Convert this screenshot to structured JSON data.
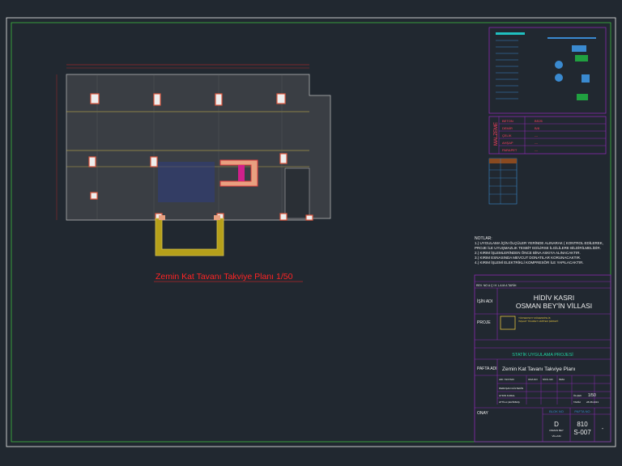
{
  "plan": {
    "title": "Zemin Kat Tavanı Takviye Planı  1/50"
  },
  "notes": {
    "heading": "NOTLAR:",
    "lines": [
      "1.) UYGULAMA İÇİN ÖLÇÜLER YERİNDE ALINARAK ( KONTROL EDİLEREK,",
      "PROJE İLE UYUŞMAZLIK TESBİT EDİLİRSE İLGİLİLERE BİLDİRİLMELİDİR.",
      "2.) KIRIM İŞLEMLERİNDEN ÖNCE BİNA ASKIYA ALINACAKTIR.",
      "3.) KIRIM ESNASINDA MEVCUT DONATILAR KORUNACAKTIR.",
      "4.) KIRIM İŞLEMİ ELEKTRİKLİ KOMPRESÖR İLE YAPILACAKTIR."
    ]
  },
  "materials": {
    "side_label": "MALZEME",
    "rows": [
      {
        "name": "BETON",
        "value": "BS25"
      },
      {
        "name": "DEMİR",
        "value": "B/8"
      },
      {
        "name": "ÇELİK",
        "value": "---"
      },
      {
        "name": "AHŞAP",
        "value": "---"
      },
      {
        "name": "PARAPET",
        "value": "---"
      }
    ]
  },
  "title_block": {
    "revision_row": "REV. NO    A Ç I K L A M A    TARİH",
    "isin_adi_label": "İŞİN ADI",
    "project_line1": "HİDİV KASRI",
    "project_line2": "OSMAN BEY'İN VİLLASI",
    "proje_label": "PROJE",
    "company_line1": "YÜKSEKSOY MÜHENDİSLİK",
    "company_line2": "İNŞAAT TİCARET LİMİTED ŞİRKETİ",
    "statik_label": "STATİK UYGULAMA PROJESİ",
    "pafta_adi_label": "PAFTA ADI",
    "pafta_adi": "Zemin Kat Tavanı Takviye Planı",
    "people_header": [
      "ADI / SOYADI",
      "ODA NO",
      "SİCİL NO",
      "İMZA"
    ],
    "people_rows": [
      "PERUŞAN GÜLTEKİN",
      "AYDIN KURAL",
      "ATTİLA ÇEVİKBAŞ"
    ],
    "scale_label": "ÖLÇEK",
    "scale": "1/50",
    "date_label": "TARİH",
    "date": "28.08.2013",
    "onay_label": "ONAY",
    "blok_no_label": "BLOK NO",
    "pafta_no_label": "PAFTA NO",
    "blok_no": "D",
    "blok_sub1": "OSMAN BEY",
    "blok_sub2": "VİLLASI",
    "pafta_no1": "810",
    "pafta_no2": "S-007",
    "rev_mark": "-"
  }
}
